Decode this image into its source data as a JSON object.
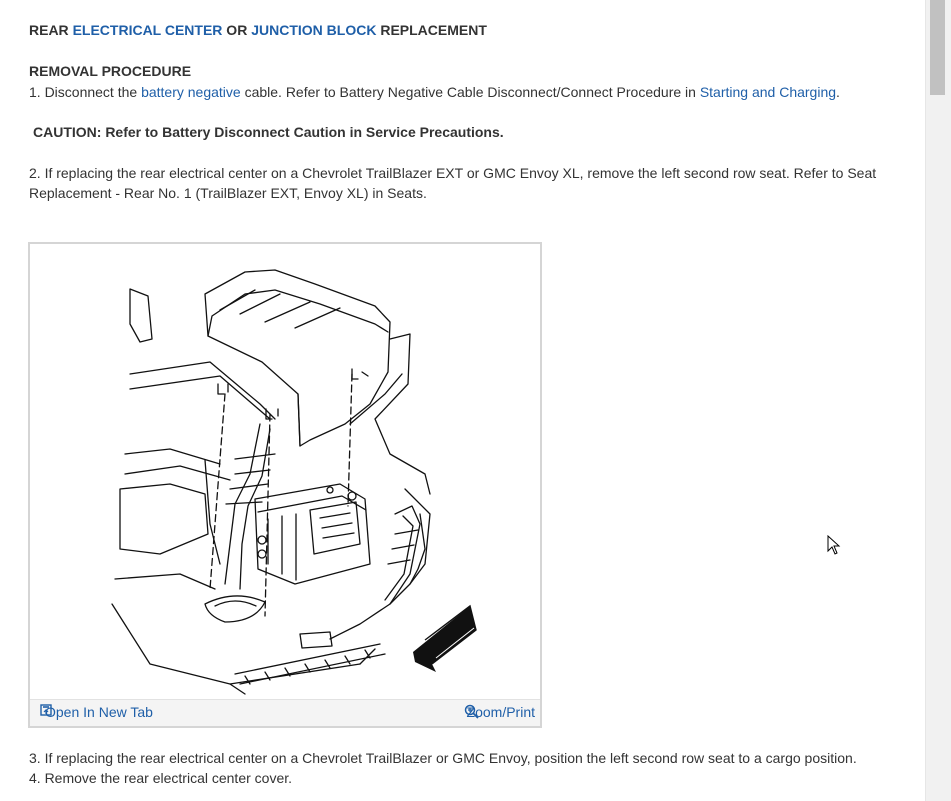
{
  "title": {
    "part1": "REAR ",
    "link1": "ELECTRICAL CENTER",
    "part2": " OR ",
    "link2": "JUNCTION BLOCK",
    "part3": " REPLACEMENT"
  },
  "removal": {
    "heading": "REMOVAL PROCEDURE",
    "step1": {
      "prefix": " 1. Disconnect the ",
      "link1": "battery negative",
      "middle": " cable. Refer to Battery Negative Cable Disconnect/Connect Procedure in ",
      "link2": "Starting and Charging",
      "suffix": "."
    },
    "caution": "CAUTION: Refer to Battery Disconnect Caution in Service Precautions.",
    "step2": " 2. If replacing the rear electrical center on a Chevrolet TrailBlazer EXT or GMC Envoy XL, remove the left second row seat. Refer to Seat Replacement - Rear No. 1 (TrailBlazer EXT, Envoy XL) in Seats.",
    "step3": " 3. If replacing the rear electrical center on a Chevrolet TrailBlazer or GMC Envoy, position the left second row seat to a cargo position.",
    "step4": " 4. Remove the rear electrical center cover."
  },
  "figure": {
    "open_label": "Open In New Tab",
    "zoom_label": "Zoom/Print",
    "open_icon": "open-in-new-tab-icon",
    "zoom_icon": "zoom-icon"
  },
  "colors": {
    "link": "#1f5fa8",
    "text": "#333333",
    "figure_border": "#d5d5d5"
  }
}
